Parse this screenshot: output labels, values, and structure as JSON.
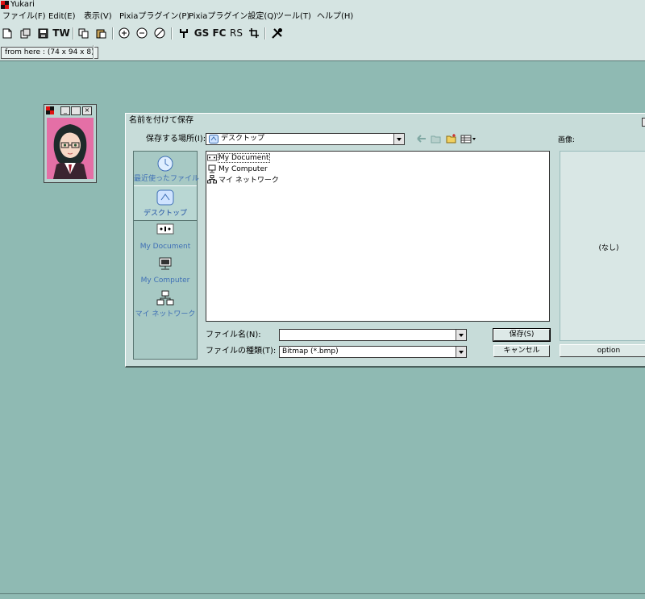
{
  "app": {
    "title": "Yukari"
  },
  "menu": [
    {
      "label": "ファイル(F)"
    },
    {
      "label": "Edit(E)"
    },
    {
      "label": "表示(V)"
    },
    {
      "label": "Pixiaプラグイン(P)"
    },
    {
      "label": "Pixiaプラグイン設定(Q)"
    },
    {
      "label": "ツール(T)"
    },
    {
      "label": "ヘルプ(H)"
    }
  ],
  "toolbar": {
    "tw": "TW",
    "gs": "GS",
    "fc": "FC",
    "rs": "RS"
  },
  "status": {
    "text": "from here : (74 x 94 x 8)"
  },
  "dialog": {
    "title": "名前を付けて保存",
    "save_in_label": "保存する場所(I):",
    "save_in_value": "デスクトップ",
    "places": [
      {
        "label": "最近使ったファイル",
        "icon": "recent-icon"
      },
      {
        "label": "デスクトップ",
        "icon": "desktop-icon"
      },
      {
        "label": "My Document",
        "icon": "my-documents-icon"
      },
      {
        "label": "My Computer",
        "icon": "my-computer-icon"
      },
      {
        "label": "マイ ネットワーク",
        "icon": "network-icon"
      }
    ],
    "files": [
      {
        "name": "My Document",
        "icon": "my-documents-icon"
      },
      {
        "name": "My Computer",
        "icon": "my-computer-icon"
      },
      {
        "name": "マイ ネットワーク",
        "icon": "network-icon"
      }
    ],
    "filename_label": "ファイル名(N):",
    "filename_value": "",
    "filetype_label": "ファイルの種類(T):",
    "filetype_value": "Bitmap (*.bmp)",
    "save_button": "保存(S)",
    "cancel_button": "キャンセル",
    "preview_label": "画像:",
    "preview_none": "(なし)",
    "option_button": "option"
  },
  "colors": {
    "workspace": "#8fbab3",
    "chrome": "#d5e4e2",
    "link_blue": "#3e6fb5"
  }
}
